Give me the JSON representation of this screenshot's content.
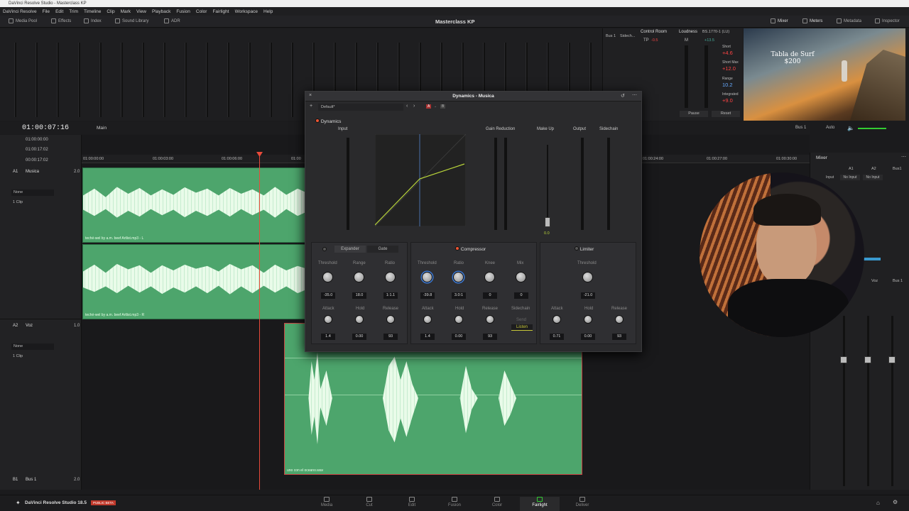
{
  "title_bar": "DaVinci Resolve Studio - Masterclass KP",
  "menu": [
    "DaVinci Resolve",
    "File",
    "Edit",
    "Trim",
    "Timeline",
    "Clip",
    "Mark",
    "View",
    "Playback",
    "Fusion",
    "Color",
    "Fairlight",
    "Workspace",
    "Help"
  ],
  "toolbar": {
    "media_pool": "Media Pool",
    "effects": "Effects",
    "index": "Index",
    "sound_library": "Sound Library",
    "adr": "ADR",
    "project_title": "Masterclass KP",
    "mixer": "Mixer",
    "meters": "Meters",
    "metadata": "Metadata",
    "inspector": "Inspector"
  },
  "control_room": {
    "bus1": "Bus 1",
    "sidechain": "Sidech...",
    "title": "Control Room",
    "tp": "TP",
    "tp_value": "-0.5",
    "loudness": "Loudness",
    "standard": "BS.1770-1 (LU)",
    "m": "M",
    "m_value": "+13.5",
    "short": "Short",
    "short_value": "+4.6",
    "short_max": "Short Max",
    "short_max_value": "+12.0",
    "range": "Range",
    "range_value": "10.2",
    "integrated": "Integrated",
    "integrated_value": "+9.0",
    "pause": "Pause",
    "reset": "Reset"
  },
  "video": {
    "overlay_line1": "Tabla de Surf",
    "overlay_line2": "$200"
  },
  "timecode": {
    "main": "01:00:07:16",
    "timeline_name": "Main",
    "tc1": "01:00:00:00",
    "tc2": "01:00:17:02",
    "tc3": "00:00:17:02"
  },
  "ruler": [
    "01:00:00:00",
    "01:00:03:00",
    "01:00:06:00",
    "01:00",
    "01:00:24:00",
    "01:00:27:00",
    "01:00:30:00"
  ],
  "tracks": [
    {
      "id": "A1",
      "name": "Musica",
      "gain": "2.0",
      "fx": "None",
      "clips": "1 Clip"
    },
    {
      "id": "A2",
      "name": "Voz",
      "gain": "1.0",
      "fx": "None",
      "clips": "1 Clip"
    },
    {
      "id": "B1",
      "name": "Bus 1",
      "gain": "2.0"
    }
  ],
  "clips": {
    "music_l": "teché-wel by a.m. beef Artlist.mp3 - L",
    "music_r": "teché-wel by a.m. beef Artlist.mp3 - R",
    "voice": "uno con el oceano.wav"
  },
  "bus_output": {
    "bus": "Bus 1",
    "auto": "Auto"
  },
  "dynamics": {
    "title": "Dynamics - Musica",
    "preset": "Default*",
    "ab": [
      "A",
      "→",
      "B"
    ],
    "dynamics_label": "Dynamics",
    "input": "Input",
    "gain_reduction": "Gain Reduction",
    "make_up": "Make Up",
    "output": "Output",
    "sidechain": "Sidechain",
    "make_up_value": "0.0",
    "expander": {
      "tab1": "Expander",
      "tab2": "Gate",
      "labels": [
        "Threshold",
        "Range",
        "Ratio",
        "Attack",
        "Hold",
        "Release"
      ],
      "values": [
        "-35.0",
        "18.0",
        "1:1.1",
        "1.4",
        "0.00",
        "93"
      ]
    },
    "compressor": {
      "title": "Compressor",
      "labels": [
        "Threshold",
        "Ratio",
        "Knee",
        "Mix",
        "Attack",
        "Hold",
        "Release",
        "Sidechain"
      ],
      "values": [
        "-39.8",
        "3.0:1",
        "0",
        "0",
        "1.4",
        "0.00",
        "93"
      ],
      "send": "Send",
      "listen": "Listen"
    },
    "limiter": {
      "title": "Limiter",
      "labels": [
        "Threshold",
        "Attack",
        "Hold",
        "Release"
      ],
      "values": [
        "-21.0",
        "0.71",
        "0.00",
        "93"
      ]
    }
  },
  "mixer": {
    "title": "Mixer",
    "cols": [
      "A1",
      "A2",
      "Bus1"
    ],
    "input": "Input",
    "no_input": "No Input",
    "voz": "Voz",
    "bus1": "Bus 1"
  },
  "pages": {
    "app": "DaVinci Resolve Studio 18.5",
    "beta": "PUBLIC BETA",
    "items": [
      "Media",
      "Cut",
      "Edit",
      "Fusion",
      "Color",
      "Fairlight",
      "Deliver"
    ],
    "selected": "Fairlight"
  }
}
